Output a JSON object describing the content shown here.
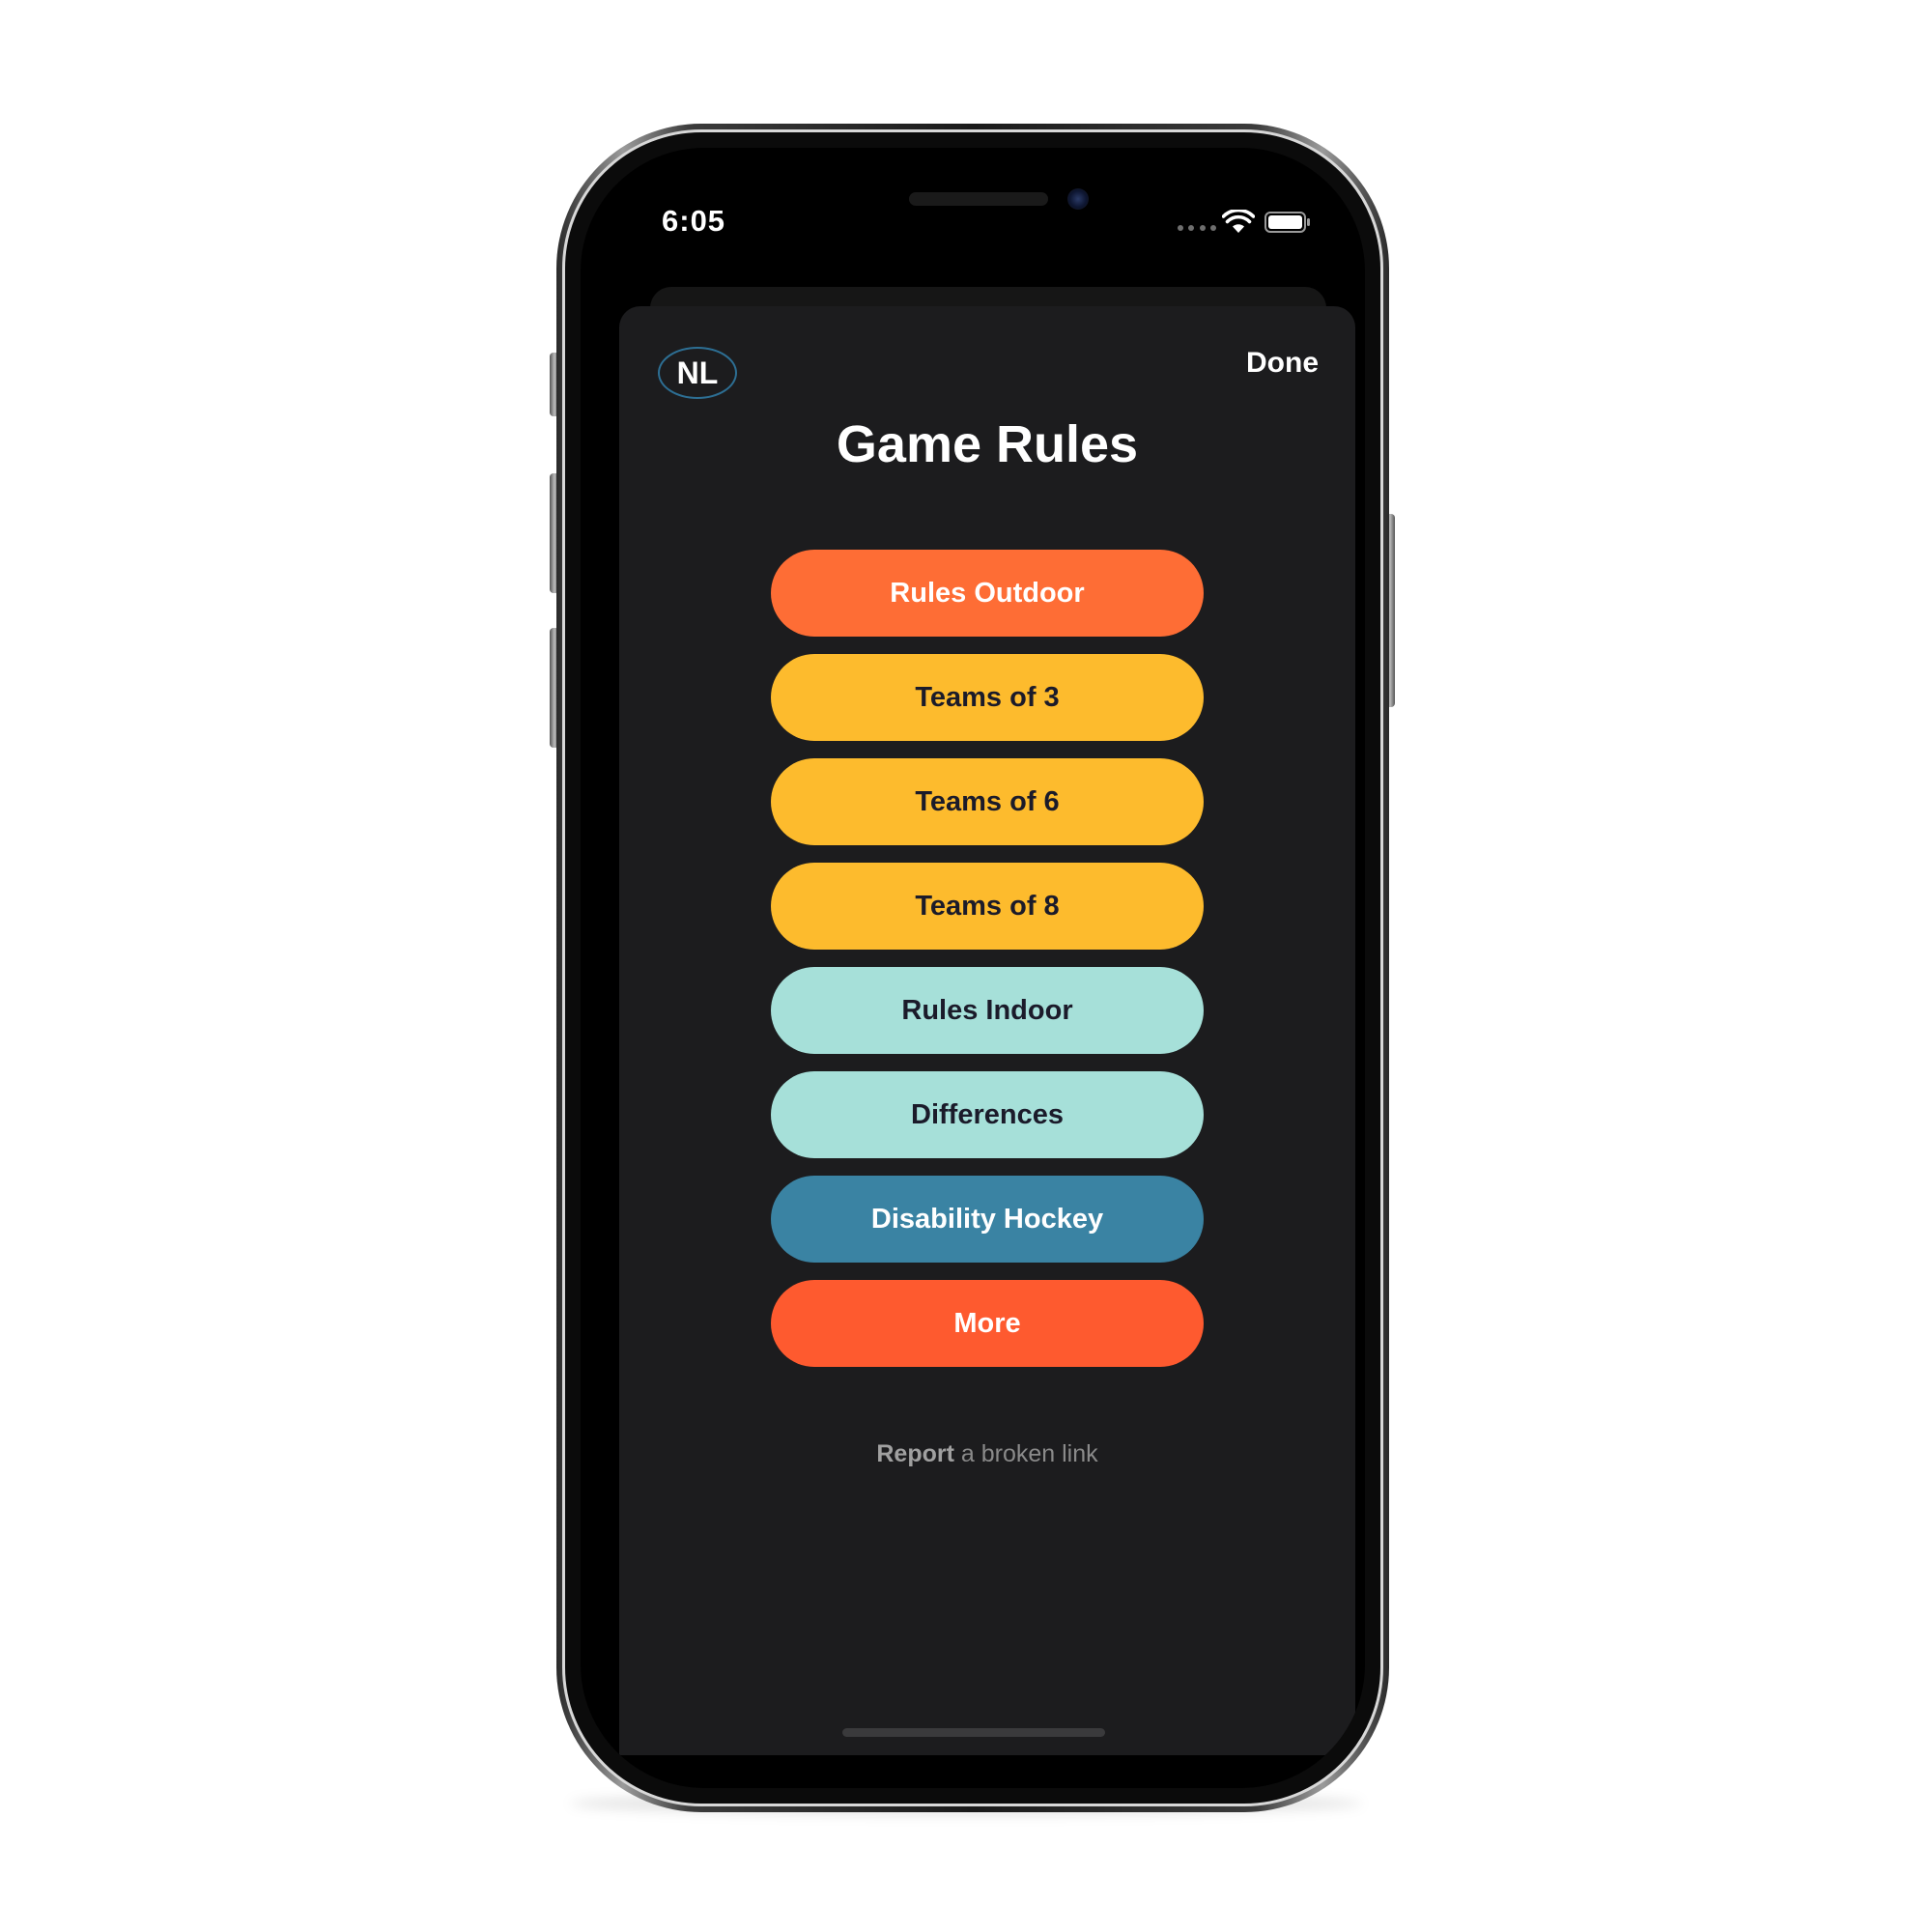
{
  "status_bar": {
    "time": "6:05"
  },
  "header": {
    "badge": "NL",
    "done_label": "Done",
    "title": "Game Rules"
  },
  "menu": {
    "items": [
      {
        "label": "Rules Outdoor",
        "bg": "#fe6d35",
        "fg": "#ffffff"
      },
      {
        "label": "Teams of 3",
        "bg": "#fdbb2d",
        "fg": "#1b1b2a"
      },
      {
        "label": "Teams of 6",
        "bg": "#fdbb2d",
        "fg": "#1b1b2a"
      },
      {
        "label": "Teams of 8",
        "bg": "#fdbb2d",
        "fg": "#1b1b2a"
      },
      {
        "label": "Rules Indoor",
        "bg": "#a6e0d9",
        "fg": "#1b1b2a"
      },
      {
        "label": "Differences",
        "bg": "#a6e0d9",
        "fg": "#1b1b2a"
      },
      {
        "label": "Disability Hockey",
        "bg": "#3a83a3",
        "fg": "#ffffff"
      },
      {
        "label": "More",
        "bg": "#fe5a2f",
        "fg": "#ffffff"
      }
    ]
  },
  "footer": {
    "report_strong": "Report",
    "report_rest": " a broken link"
  },
  "icons": {
    "wifi": "wifi-icon",
    "battery": "battery-icon",
    "signal": "signal-dots-icon"
  },
  "colors": {
    "sheet_bg": "#1c1c1e",
    "badge_border": "#2d6f94"
  }
}
